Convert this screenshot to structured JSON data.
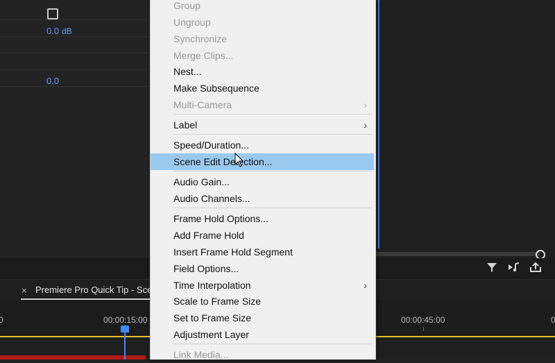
{
  "panel_left": {
    "volume_value": "0.0",
    "volume_unit": "dB",
    "balance_value": "0.0"
  },
  "sequence_tab": {
    "close_glyph": "×",
    "title": "Premiere Pro Quick Tip - Scer"
  },
  "ruler": {
    "tc_left_partial": "0",
    "tc_15": "00:00:15:00",
    "tc_45": "00:00:45:00",
    "tc_right_partial": "0"
  },
  "context_menu": {
    "items": [
      {
        "label": "Group",
        "disabled": true
      },
      {
        "label": "Ungroup",
        "disabled": true
      },
      {
        "label": "Synchronize",
        "disabled": true
      },
      {
        "label": "Merge Clips...",
        "disabled": true
      },
      {
        "label": "Nest...",
        "disabled": false
      },
      {
        "label": "Make Subsequence",
        "disabled": false
      },
      {
        "label": "Multi-Camera",
        "disabled": true,
        "submenu": true
      },
      {
        "label": "Label",
        "disabled": false,
        "submenu": true
      },
      {
        "label": "Speed/Duration...",
        "disabled": false
      },
      {
        "label": "Scene Edit Detection...",
        "disabled": false,
        "highlighted": true
      },
      {
        "label": "Audio Gain...",
        "disabled": false
      },
      {
        "label": "Audio Channels...",
        "disabled": false
      },
      {
        "label": "Frame Hold Options...",
        "disabled": false
      },
      {
        "label": "Add Frame Hold",
        "disabled": false
      },
      {
        "label": "Insert Frame Hold Segment",
        "disabled": false
      },
      {
        "label": "Field Options...",
        "disabled": false
      },
      {
        "label": "Time Interpolation",
        "disabled": false,
        "submenu": true
      },
      {
        "label": "Scale to Frame Size",
        "disabled": false
      },
      {
        "label": "Set to Frame Size",
        "disabled": false
      },
      {
        "label": "Adjustment Layer",
        "disabled": false
      },
      {
        "label": "Link Media...",
        "disabled": true
      }
    ],
    "submenu_arrow": "›"
  },
  "icons": {
    "filter": "filter-icon",
    "audio_output": "audio-output-icon",
    "export": "export-icon"
  },
  "colors": {
    "highlight": "#99c9ef",
    "accent_blue": "#3d82ff",
    "timeline_yellow": "#e6c330",
    "clip_red": "#b01a1a"
  }
}
